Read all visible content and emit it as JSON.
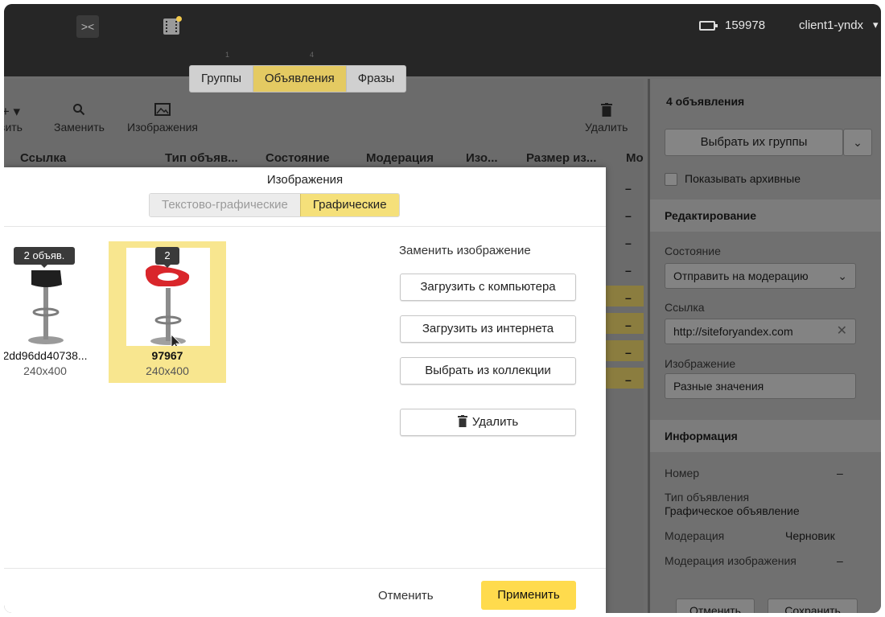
{
  "topbar": {
    "balance": "159978",
    "login": "client1-yndx",
    "collapse_glyph": "><",
    "step1": "1",
    "step2": "4"
  },
  "tabs": [
    {
      "label": "Группы",
      "active": false
    },
    {
      "label": "Объявления",
      "active": true
    },
    {
      "label": "Фразы",
      "active": false
    }
  ],
  "toolbar": {
    "add_label": "вить",
    "replace_label": "Заменить",
    "images_label": "Изображения",
    "delete_label": "Удалить"
  },
  "table": {
    "headers": [
      "Ссылка",
      "Тип объяв...",
      "Состояние",
      "Модерация",
      "Изо...",
      "Размер из...",
      "Мо"
    ],
    "dash": "–"
  },
  "sidebar": {
    "title": "4 объявления",
    "select_groups": "Выбрать их группы",
    "show_archived": "Показывать архивные",
    "edit_section": "Редактирование",
    "state_label": "Состояние",
    "state_value": "Отправить на модерацию",
    "link_label": "Ссылка",
    "link_value": "http://siteforyandex.com",
    "image_label": "Изображение",
    "image_value": "Разные значения",
    "info_section": "Информация",
    "number_label": "Номер",
    "number_value": "–",
    "ad_type_label": "Тип объявления",
    "ad_type_value": "Графическое объявление",
    "moderation_label": "Модерация",
    "moderation_value": "Черновик",
    "image_moderation_label": "Модерация изображения",
    "image_moderation_value": "–",
    "cancel": "Отменить",
    "save": "Сохранить"
  },
  "modal": {
    "title": "Изображения",
    "segments": [
      {
        "label": "Текстово-графические",
        "active": false
      },
      {
        "label": "Графические",
        "active": true
      }
    ],
    "cards": [
      {
        "badge": "2 объяв.",
        "name": "2dd96dd40738...",
        "size": "240x400",
        "selected": false,
        "seat_color": "#1f1f1f"
      },
      {
        "badge": "2",
        "name": "97967",
        "size": "240x400",
        "selected": true,
        "seat_color": "#d9262b"
      }
    ],
    "replace_title": "Заменить изображение",
    "upload_computer": "Загрузить с компьютера",
    "upload_internet": "Загрузить из интернета",
    "choose_collection": "Выбрать из коллекции",
    "delete": "Удалить",
    "cancel": "Отменить",
    "apply": "Применить"
  },
  "colors": {
    "accent": "#ffdb4d",
    "selected_card": "#f8e68f",
    "active_tab": "#e4ca62"
  }
}
